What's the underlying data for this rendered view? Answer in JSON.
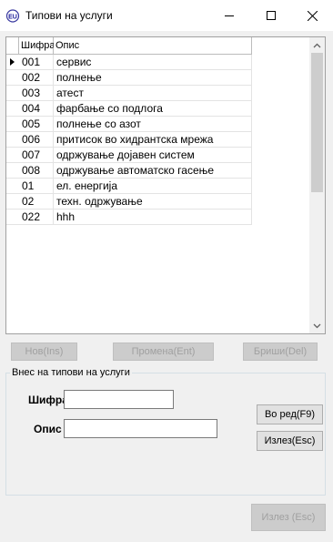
{
  "window": {
    "title": "Типови на услуги",
    "icon": "app-icon",
    "minimize_icon": "minimize-icon",
    "maximize_icon": "maximize-icon",
    "close_icon": "close-icon"
  },
  "grid": {
    "columns": [
      "Шифра",
      "Опис"
    ],
    "rows": [
      {
        "code": "001",
        "desc": "сервис"
      },
      {
        "code": "002",
        "desc": "полнење"
      },
      {
        "code": "003",
        "desc": "атест"
      },
      {
        "code": "004",
        "desc": "фарбање со подлога"
      },
      {
        "code": "005",
        "desc": "полнење со азот"
      },
      {
        "code": "006",
        "desc": "притисок во хидрантска мрежа"
      },
      {
        "code": "007",
        "desc": "одржување дојавен систем"
      },
      {
        "code": "008",
        "desc": "одржување автоматско гасење"
      },
      {
        "code": "01",
        "desc": "ел. енергија"
      },
      {
        "code": "02",
        "desc": "техн. одржување"
      },
      {
        "code": "022",
        "desc": "hhh"
      }
    ],
    "current_row_index": 0
  },
  "toolbar": {
    "new_label": "Нов(Ins)",
    "edit_label": "Промена(Ent)",
    "delete_label": "Бриши(Del)"
  },
  "entry": {
    "group_title": "Внес на типови на услуги",
    "code_label": "Шифра",
    "code_value": "",
    "desc_label": "Опис",
    "desc_value": "",
    "ok_label": "Во ред(F9)",
    "cancel_label": "Излез(Esc)"
  },
  "footer": {
    "exit_label": "Излез (Esc)"
  }
}
